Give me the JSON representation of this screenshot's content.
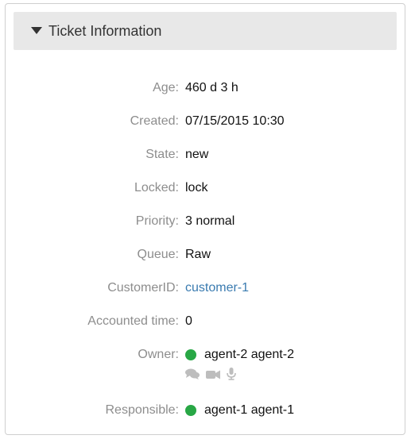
{
  "panel": {
    "title": "Ticket Information",
    "toggle_icon": "caret-down-icon"
  },
  "fields": {
    "age": {
      "label": "Age:",
      "value": "460 d 3 h"
    },
    "created": {
      "label": "Created:",
      "value": "07/15/2015 10:30"
    },
    "state": {
      "label": "State:",
      "value": "new"
    },
    "locked": {
      "label": "Locked:",
      "value": "lock"
    },
    "priority": {
      "label": "Priority:",
      "value": "3 normal"
    },
    "queue": {
      "label": "Queue:",
      "value": "Raw"
    },
    "customer_id": {
      "label": "CustomerID:",
      "value": "customer-1"
    },
    "accounted_time": {
      "label": "Accounted time:",
      "value": "0"
    },
    "owner": {
      "label": "Owner:",
      "value": "agent-2 agent-2",
      "status_color": "#28a745"
    },
    "responsible": {
      "label": "Responsible:",
      "value": "agent-1 agent-1",
      "status_color": "#28a745"
    }
  },
  "owner_contact_icons": [
    "chat-icon",
    "video-icon",
    "microphone-icon"
  ],
  "colors": {
    "header_bg": "#e8e8e8",
    "label": "#8d8d8d",
    "link": "#3a7bb0",
    "online": "#28a745",
    "contact_icons": "#bdbdbd"
  }
}
